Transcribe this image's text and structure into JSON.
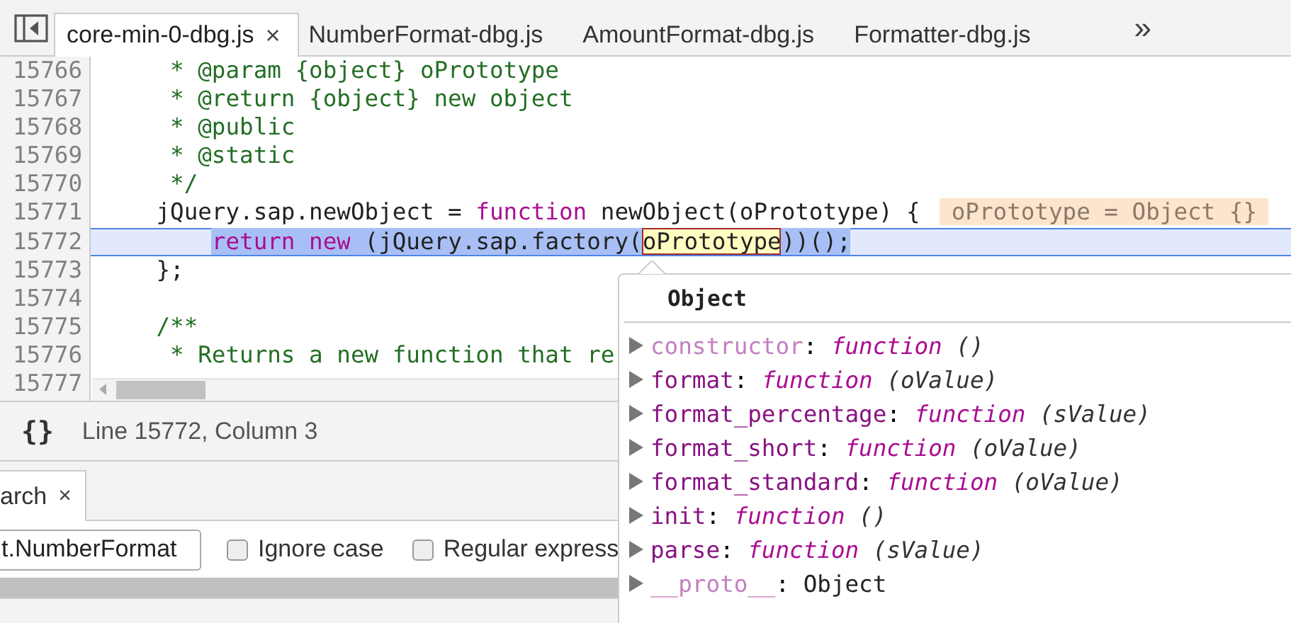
{
  "tabs": [
    {
      "label": "core-min-0-dbg.js",
      "selected": true,
      "close": "×"
    },
    {
      "label": "NumberFormat-dbg.js",
      "selected": false
    },
    {
      "label": "AmountFormat-dbg.js",
      "selected": false
    },
    {
      "label": "Formatter-dbg.js",
      "selected": false
    }
  ],
  "more_tabs": "»",
  "editor": {
    "lines": [
      {
        "number": "15766",
        "current": false,
        "tokens": [
          {
            "kind": "comment",
            "text": "     * @param {object} oPrototype"
          }
        ]
      },
      {
        "number": "15767",
        "current": false,
        "tokens": [
          {
            "kind": "comment",
            "text": "     * @return {object} new object"
          }
        ]
      },
      {
        "number": "15768",
        "current": false,
        "tokens": [
          {
            "kind": "comment",
            "text": "     * @public"
          }
        ]
      },
      {
        "number": "15769",
        "current": false,
        "tokens": [
          {
            "kind": "comment",
            "text": "     * @static"
          }
        ]
      },
      {
        "number": "15770",
        "current": false,
        "tokens": [
          {
            "kind": "comment",
            "text": "     */"
          }
        ]
      },
      {
        "number": "15771",
        "current": false,
        "tokens": [
          {
            "kind": "plain",
            "text": "    jQuery.sap.newObject = "
          },
          {
            "kind": "keyword",
            "text": "function"
          },
          {
            "kind": "plain",
            "text": " newObject(oPrototype) {"
          }
        ],
        "inline_value": "oPrototype = Object {}"
      },
      {
        "number": "15772",
        "current": true,
        "tokens": [
          {
            "kind": "keyword",
            "text": "        return",
            "selected": true,
            "highlighted": false
          },
          {
            "kind": "keyword",
            "text": " new",
            "selected": true,
            "highlighted": false
          },
          {
            "kind": "plain",
            "text": " (jQuery.sap.factory(",
            "selected": true,
            "highlighted": false
          },
          {
            "kind": "plain",
            "text": "oPrototype",
            "selected": true,
            "highlighted": true
          },
          {
            "kind": "plain",
            "text": "))();",
            "selected": true,
            "highlighted": false
          }
        ]
      },
      {
        "number": "15773",
        "current": false,
        "tokens": [
          {
            "kind": "plain",
            "text": "    };"
          }
        ]
      },
      {
        "number": "15774",
        "current": false
      },
      {
        "number": "15775",
        "current": false,
        "tokens": [
          {
            "kind": "comment",
            "text": "    /**"
          }
        ]
      },
      {
        "number": "15776",
        "current": false,
        "tokens": [
          {
            "kind": "comment",
            "text": "     * Returns a new function that re"
          }
        ]
      },
      {
        "number": "15777",
        "current": false
      }
    ]
  },
  "status_bar": {
    "format_icon": "{}",
    "position": "Line 15772, Column 3"
  },
  "drawer": {
    "tab": {
      "label": "arch",
      "close": "×",
      "selected": true
    },
    "search": {
      "value": "t.NumberFormat"
    },
    "options": [
      {
        "label": "Ignore case",
        "checked": false
      },
      {
        "label": "Regular express",
        "checked": false
      }
    ]
  },
  "popover": {
    "title": "Object",
    "properties": [
      {
        "name": "constructor",
        "separator": ":",
        "own": false,
        "kind": "function",
        "value": "function",
        "args": "()"
      },
      {
        "name": "format",
        "separator": ":",
        "own": true,
        "kind": "function",
        "value": "function",
        "args": "(oValue)"
      },
      {
        "name": "format_percentage",
        "separator": ":",
        "own": true,
        "kind": "function",
        "value": "function",
        "args": "(sValue)"
      },
      {
        "name": "format_short",
        "separator": ":",
        "own": true,
        "kind": "function",
        "value": "function",
        "args": "(oValue)"
      },
      {
        "name": "format_standard",
        "separator": ":",
        "own": true,
        "kind": "function",
        "value": "function",
        "args": "(oValue)"
      },
      {
        "name": "init",
        "separator": ":",
        "own": true,
        "kind": "function",
        "value": "function",
        "args": "()"
      },
      {
        "name": "parse",
        "separator": ":",
        "own": true,
        "kind": "function",
        "value": "function",
        "args": "(sValue)"
      },
      {
        "name": "__proto__",
        "separator": ":",
        "own": false,
        "kind": "object",
        "value": "Object"
      }
    ]
  }
}
